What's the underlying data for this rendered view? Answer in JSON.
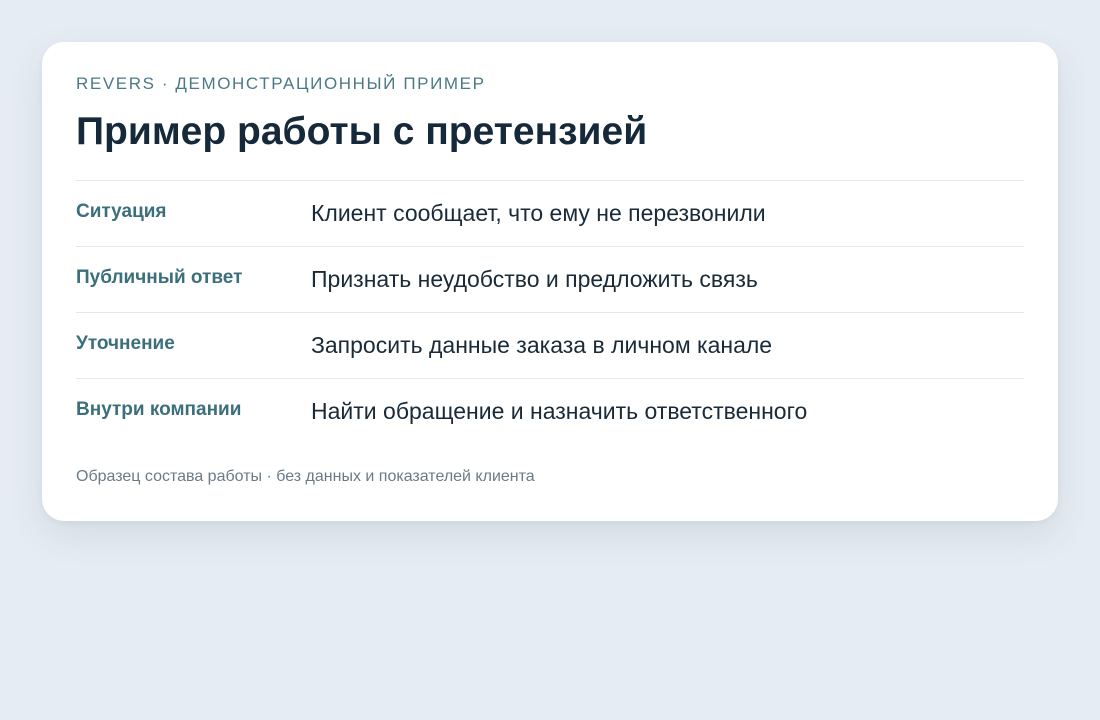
{
  "card": {
    "eyebrow": "REVERS · ДЕМОНСТРАЦИОННЫЙ ПРИМЕР",
    "title": "Пример работы с претензией",
    "rows": [
      {
        "label": "Ситуация",
        "value": "Клиент сообщает, что ему не перезвонили"
      },
      {
        "label": "Публичный ответ",
        "value": "Признать неудобство и предложить связь"
      },
      {
        "label": "Уточнение",
        "value": "Запросить данные заказа в личном канале"
      },
      {
        "label": "Внутри компании",
        "value": "Найти обращение и назначить ответственного"
      }
    ],
    "footnote": "Образец состава работы · без данных и показателей клиента"
  },
  "colors": {
    "page_background": "#e6ecf3",
    "card_background": "#ffffff",
    "accent": "#3c6f7c",
    "title_text": "#15293a",
    "muted_text": "#6c7a86"
  }
}
